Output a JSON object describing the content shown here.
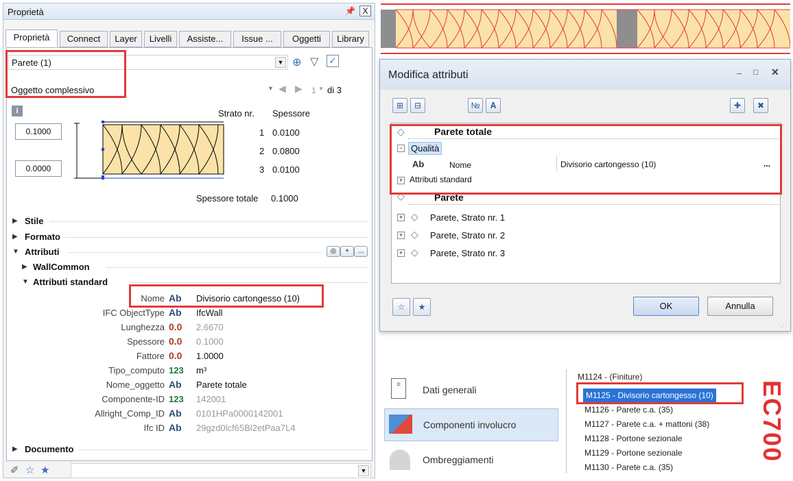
{
  "panel": {
    "title": "Proprietà",
    "pin_glyph": "14",
    "close_glyph": "X",
    "tabs": [
      "Proprietà",
      "Connect",
      "Layer",
      "Livelli",
      "Assiste...",
      "Issue ...",
      "Oggetti",
      "Library"
    ],
    "selection_value": "Parete (1)",
    "object_value": "Oggetto complessivo",
    "nav_counter": "1",
    "nav_of": "di 3",
    "layers": {
      "header_nr": "Strato nr.",
      "header_thk": "Spessore",
      "top_value": "0.1000",
      "bottom_value": "0.0000",
      "rows": [
        {
          "nr": "1",
          "thk": "0.0100"
        },
        {
          "nr": "2",
          "thk": "0.0800"
        },
        {
          "nr": "3",
          "thk": "0.0100"
        }
      ],
      "total_label": "Spessore totale",
      "total_value": "0.1000"
    },
    "sections": {
      "stile": "Stile",
      "formato": "Formato",
      "attributi": "Attributi",
      "wallcommon": "WallCommon",
      "attributi_standard": "Attributi standard",
      "documento": "Documento"
    },
    "attr_rows": [
      {
        "label": "Nome",
        "type": "Ab",
        "value": "Divisorio cartongesso (10)",
        "grey": false
      },
      {
        "label": "IFC ObjectType",
        "type": "Ab",
        "value": "IfcWall",
        "grey": false
      },
      {
        "label": "Lunghezza",
        "type": "0.0",
        "value": "2.6670",
        "grey": true
      },
      {
        "label": "Spessore",
        "type": "0.0",
        "value": "0.1000",
        "grey": true
      },
      {
        "label": "Fattore",
        "type": "0.0",
        "value": "1.0000",
        "grey": false
      },
      {
        "label": "Tipo_computo",
        "type": "123",
        "value": "m³",
        "grey": false
      },
      {
        "label": "Nome_oggetto",
        "type": "Ab",
        "value": "Parete totale",
        "grey": false
      },
      {
        "label": "Componente-ID",
        "type": "123",
        "value": "142001",
        "grey": true
      },
      {
        "label": "Allright_Comp_ID",
        "type": "Ab",
        "value": "0101HPa0000142001",
        "grey": true
      },
      {
        "label": "Ifc ID",
        "type": "Ab",
        "value": "29gzd0lcf65Bl2etPaa7L4",
        "grey": true
      }
    ],
    "mini_plus": "+",
    "mini_dots": "..."
  },
  "dialog": {
    "title": "Modifica attributi",
    "tree": {
      "parete_totale": "Parete totale",
      "qualita": "Qualità",
      "ab": "Ab",
      "nome_label": "Nome",
      "nome_value": "Divisorio cartongesso (10)",
      "dots": "...",
      "attributi_standard": "Attributi standard",
      "parete": "Parete",
      "strati": [
        "Parete, Strato nr. 1",
        "Parete, Strato nr. 2",
        "Parete, Strato nr. 3"
      ]
    },
    "ok": "OK",
    "annulla": "Annulla"
  },
  "nav": {
    "items": [
      "Dati generali",
      "Componenti involucro",
      "Ombreggiamenti"
    ],
    "list": [
      "M1124 -  (Finiture)",
      "M1125 - Divisorio cartongesso (10)",
      "M1126 - Parete c.a. (35)",
      "M1127 - Parete c.a. + mattoni (38)",
      "M1128 - Portone sezionale",
      "M1129 - Portone sezionale",
      "M1130 - Parete c.a. (35)"
    ],
    "brand": "EC700"
  },
  "colors": {
    "highlight_red": "#e23b3b",
    "insulation_fill": "#fbe2a8",
    "selected_blue": "#2a73d6",
    "brand_red": "#e53030"
  }
}
